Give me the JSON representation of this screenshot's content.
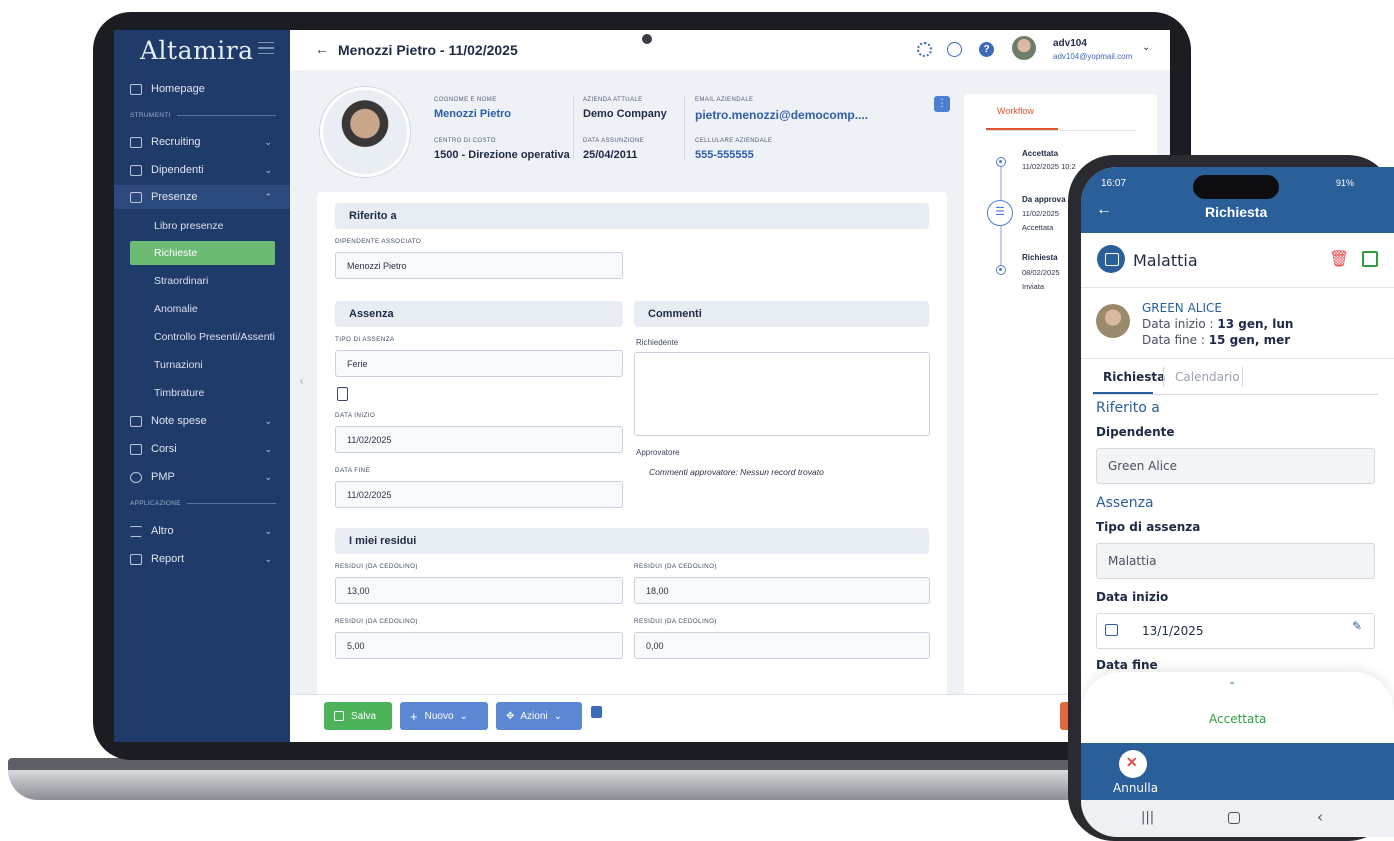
{
  "laptop": {
    "app_name": "Altamira",
    "page_title": "Menozzi Pietro - 11/02/2025",
    "user": {
      "name": "adv104",
      "email": "adv104@yopmail.com"
    },
    "sidebar": {
      "homepage": "Homepage",
      "section_strumenti": "STRUMENTI",
      "section_applicazione": "APPLICAZIONE",
      "items": [
        "Recruiting",
        "Dipendenti",
        "Presenze",
        "Note spese",
        "Corsi",
        "PMP",
        "Altro",
        "Report"
      ],
      "presenze_sub": [
        "Libro presenze",
        "Richieste",
        "Straordinari",
        "Anomalie",
        "Controllo Presenti/Assenti",
        "Turnazioni",
        "Timbrature"
      ]
    },
    "profile": {
      "label_name": "COGNOME E NOME",
      "name": "Menozzi Pietro",
      "label_company": "AZIENDA ATTUALE",
      "company": "Demo Company",
      "label_email": "EMAIL AZIENDALE",
      "email": "pietro.menozzi@democomp....",
      "label_cost": "CENTRO DI COSTO",
      "cost": "1500 - Direzione operativa",
      "label_hire": "DATA ASSUNZIONE",
      "hire": "25/04/2011",
      "label_phone": "CELLULARE AZIENDALE",
      "phone": "555-555555"
    },
    "form": {
      "riferito": "Riferito a",
      "label_dip": "DIPENDENTE ASSOCIATO",
      "dip": "Menozzi Pietro",
      "assenza": "Assenza",
      "label_tipo": "TIPO DI ASSENZA",
      "tipo": "Ferie",
      "label_inizio": "DATA INIZIO",
      "inizio": "11/02/2025",
      "label_fine": "DATA FINE",
      "fine": "11/02/2025",
      "commenti": "Commenti",
      "richiedente": "Richiedente",
      "approvatore": "Approvatore",
      "note_approvatore": "Commenti approvatore: Nessun record trovato",
      "residui": "I miei residui",
      "label_res": "RESIDUI (DA CEDOLINO)",
      "res_values": [
        "13,00",
        "18,00",
        "5,00",
        "0,00"
      ]
    },
    "workflow": {
      "tab": "Workflow",
      "steps": [
        {
          "title": "Accettata",
          "sub": "11/02/2025 10:2",
          "sub2": ""
        },
        {
          "title": "Da approva",
          "sub": "11/02/2025",
          "sub2": "Accettata"
        },
        {
          "title": "Richiesta",
          "sub": "08/02/2025",
          "sub2": "Inviata"
        }
      ]
    },
    "buttons": {
      "salva": "Salva",
      "nuovo": "Nuovo",
      "azioni": "Azioni"
    }
  },
  "phone": {
    "time": "16:07",
    "status": "91%",
    "header_title": "Richiesta",
    "type_title": "Malattia",
    "person": "GREEN ALICE",
    "start_label": "Data inizio : ",
    "start_value": "13 gen, lun",
    "end_label": "Data fine : ",
    "end_value": "15 gen, mer",
    "tabs": [
      "Richiesta",
      "Calendario"
    ],
    "section_riferito": "Riferito a",
    "label_dip": "Dipendente",
    "dip": "Green Alice",
    "section_assenza": "Assenza",
    "label_tipo": "Tipo di assenza",
    "tipo": "Malattia",
    "label_inizio": "Data inizio",
    "inizio": "13/1/2025",
    "label_fine": "Data fine",
    "status_text": "Accettata",
    "annulla": "Annulla"
  },
  "colors": {
    "brand": "#1f3b6a",
    "accent_green": "#6dbb72",
    "phone_blue": "#2a5f9a",
    "workflow_orange": "#e0562d"
  }
}
